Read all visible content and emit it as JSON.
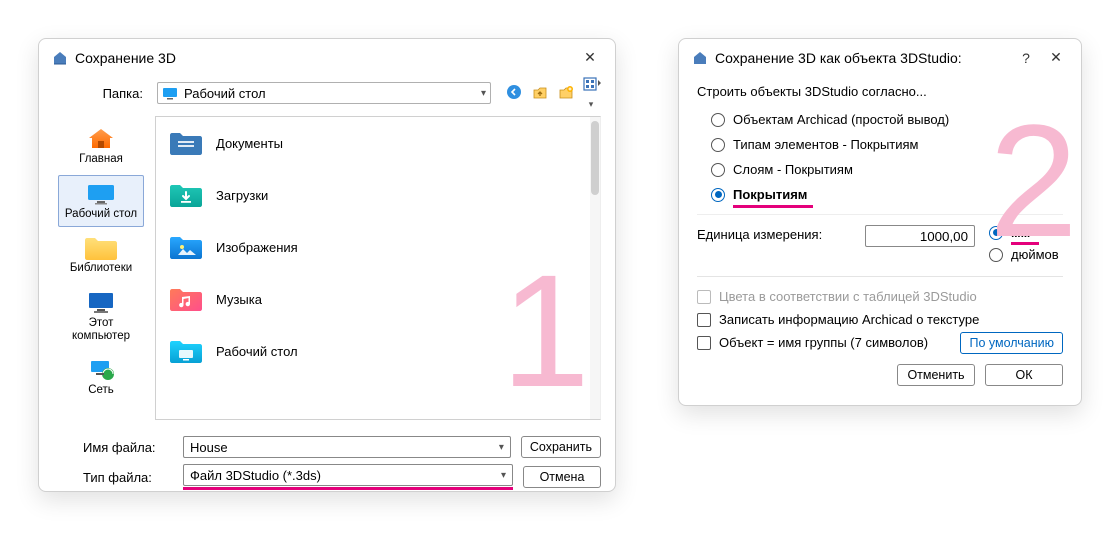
{
  "dialog1": {
    "title": "Сохранение 3D",
    "folder_label": "Папка:",
    "folder_value": "Рабочий стол",
    "sidebar": [
      {
        "label": "Главная",
        "icon": "home"
      },
      {
        "label": "Рабочий стол",
        "icon": "desktop",
        "selected": true
      },
      {
        "label": "Библиотеки",
        "icon": "libraries"
      },
      {
        "label": "Этот компьютер",
        "icon": "pc"
      },
      {
        "label": "Сеть",
        "icon": "network"
      }
    ],
    "files": [
      {
        "name": "Документы",
        "icon": "docs"
      },
      {
        "name": "Загрузки",
        "icon": "downloads"
      },
      {
        "name": "Изображения",
        "icon": "pictures"
      },
      {
        "name": "Музыка",
        "icon": "music"
      },
      {
        "name": "Рабочий стол",
        "icon": "desktop"
      }
    ],
    "file_name_label": "Имя файла:",
    "file_name_value": "House",
    "file_type_label": "Тип файла:",
    "file_type_value": "Файл 3DStudio (*.3ds)",
    "save_btn": "Сохранить",
    "cancel_btn": "Отмена",
    "big_number": "1"
  },
  "dialog2": {
    "title": "Сохранение 3D как объекта 3DStudio:",
    "heading": "Строить объекты 3DStudio согласно...",
    "radios": [
      {
        "label": "Объектам Archicad (простой вывод)",
        "selected": false
      },
      {
        "label": "Типам элементов - Покрытиям",
        "selected": false
      },
      {
        "label": "Слоям - Покрытиям",
        "selected": false
      },
      {
        "label": "Покрытиям",
        "selected": true
      }
    ],
    "unit_label": "Единица измерения:",
    "unit_value": "1000,00",
    "unit_options": [
      {
        "label": "мм",
        "selected": true
      },
      {
        "label": "дюймов",
        "selected": false
      }
    ],
    "check_colors": "Цвета в соответствии с таблицей 3DStudio",
    "check_texture": "Записать информацию Archicad о текстуре",
    "check_group": "Объект = имя группы (7 символов)",
    "defaults_btn": "По умолчанию",
    "cancel_btn": "Отменить",
    "ok_btn": "ОК",
    "big_number": "2"
  }
}
